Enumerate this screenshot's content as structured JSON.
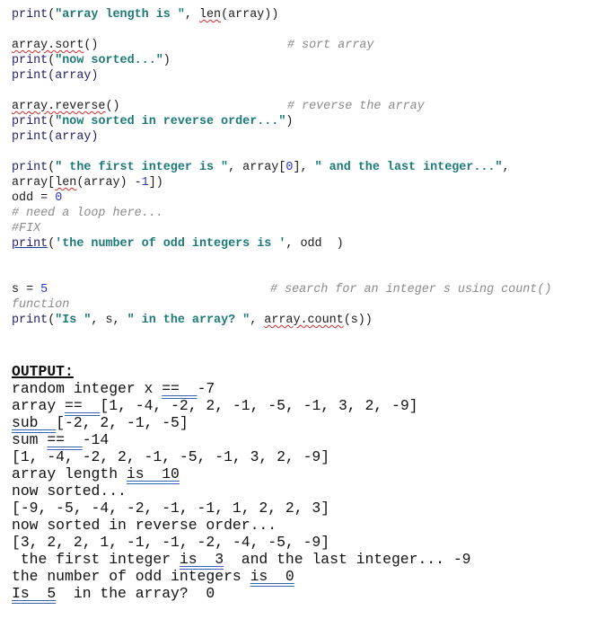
{
  "code": {
    "l1_print": "print",
    "l1_open": "(",
    "l1_str": "\"array length is \"",
    "l1_comma": ", ",
    "l1_len": "len",
    "l1_rest": "(array))",
    "l2_call": "array.sort",
    "l2_paren": "()",
    "l2_comment": "# sort array",
    "l3_print": "print",
    "l3_open": "(",
    "l3_str": "\"now sorted...\"",
    "l3_close": ")",
    "l4": "print(array)",
    "l5_call": "array.reverse",
    "l5_paren": "()",
    "l5_comment": "# reverse the array",
    "l6_print": "print",
    "l6_open": "(",
    "l6_str": "\"now sorted in reverse order...\"",
    "l6_close": ")",
    "l7": "print(array)",
    "l8_print": "print",
    "l8_open": "(",
    "l8_str1": "\" the first integer is \"",
    "l8_mid1": ", array[",
    "l8_idx": "0",
    "l8_mid2": "], ",
    "l8_str2": "\" and the last integer...\"",
    "l8_end": ",",
    "l9_a": "array[",
    "l9_len": "len",
    "l9_b": "(array) -",
    "l9_num": "1",
    "l9_c": "])",
    "l10_a": "odd = ",
    "l10_num": "0",
    "l11_comment": "# need a loop here...",
    "l12_comment": "#FIX",
    "l13_print": "print",
    "l13_open": "(",
    "l13_str": "'the number of odd integers is '",
    "l13_rest": ", odd  )",
    "l14_a": "s = ",
    "l14_num": "5",
    "l14_comment": "# search for an integer s using count()",
    "l15_comment": "function",
    "l16_print": "print",
    "l16_open": "(",
    "l16_str1": "\"Is \"",
    "l16_mid": ", s, ",
    "l16_str2": "\" in the array? \"",
    "l16_comma": ", ",
    "l16_call": "array.count",
    "l16_rest": "(s))"
  },
  "output": {
    "title": "OUTPUT:",
    "o1_a": "random integer x ",
    "o1_u": "==  ",
    "o1_b": "-7",
    "o2_a": "array ",
    "o2_u": "==  ",
    "o2_b": "[1, -4, -2, 2, -1, -5, -1, 3, 2, -9]",
    "o3_u": "sub  ",
    "o3_b": "[-2, 2, -1, -5]",
    "o4_a": "sum ",
    "o4_u": "==  ",
    "o4_b": "-14",
    "o5": "[1, -4, -2, 2, -1, -5, -1, 3, 2, -9]",
    "o6_a": "array length ",
    "o6_u": "is  10",
    "o7": "now sorted...",
    "o8": "[-9, -5, -4, -2, -1, -1, 1, 2, 2, 3]",
    "o9": "now sorted in reverse order...",
    "o10": "[3, 2, 2, 1, -1, -1, -2, -4, -5, -9]",
    "o11_a": " the first integer ",
    "o11_u": "is  3",
    "o11_b": "  and the last integer... -9",
    "o12_a": "the number of odd integers ",
    "o12_u": "is  0",
    "o13_u": "Is  5",
    "o13_b": "  in the array?  0"
  }
}
